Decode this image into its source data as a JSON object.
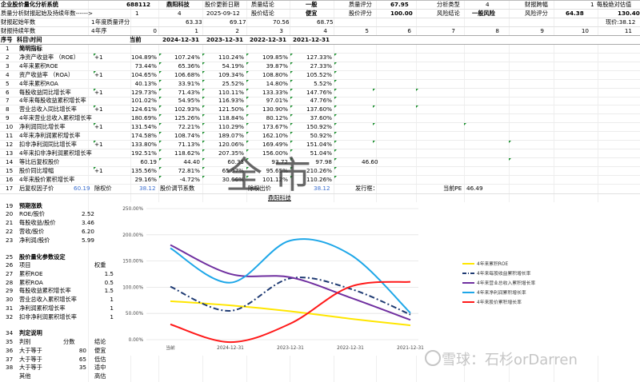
{
  "top": {
    "row1": {
      "c1": "企业股价量化分析系统",
      "c2": "688112",
      "c3": "鼎阳科技",
      "c4": "股价更新日期",
      "c5": "质量结论",
      "c6": "一般",
      "c7": "质量评分",
      "c8": "67.95",
      "c9": "分析类型",
      "c10": "4",
      "c11": "财报跨幅",
      "c12": "1",
      "c13": "每股绝对估值"
    },
    "row2": {
      "c1": "质量分析财报起始及持续年数------>",
      "c2": "1",
      "c3": "4",
      "c4": "2025-09-12",
      "c5": "股价结论",
      "c6": "便宜",
      "c7": "股价评分",
      "c8": "100.00",
      "c9": "风险结论",
      "c10": "一般风险",
      "c11": "风险评分",
      "c12": "64.38",
      "c13": "130.40"
    },
    "row3": {
      "c1": "财报起始年数",
      "c2": "1",
      "c3": "年度质量评分",
      "c4": "63.33",
      "c5": "69.17",
      "c6": "70.56",
      "c7": "68.75",
      "c8": "现价:38.12"
    },
    "row4": {
      "c1": "财报持续年数",
      "c2": "4",
      "c3": "年序",
      "n": [
        "0",
        "1",
        "2",
        "3",
        "4",
        "5",
        "6",
        "7",
        "8",
        "9",
        "10",
        "11"
      ]
    }
  },
  "header": {
    "idx": "序号",
    "item": "科目\\时间",
    "cols": [
      "当前",
      "2024-12-31",
      "2023-12-31",
      "2022-12-31",
      "2021-12-31"
    ]
  },
  "table": [
    {
      "n": "1",
      "name": "简明指标",
      "b": true,
      "flag": "",
      "v": []
    },
    {
      "n": "2",
      "name": "净资产收益率 （ROE）",
      "flag": "+1",
      "v": [
        "104.89%",
        "107.24%",
        "110.24%",
        "109.85%",
        "127.33%"
      ]
    },
    {
      "n": "3",
      "name": "4年来累积ROE",
      "flag": "",
      "v": [
        "73.44%",
        "65.36%",
        "54.19%",
        "39.87%",
        "27.33%"
      ]
    },
    {
      "n": "4",
      "name": "资产收益率 （ROA）",
      "flag": "+1",
      "v": [
        "104.65%",
        "106.68%",
        "109.34%",
        "108.80%",
        "105.52%"
      ]
    },
    {
      "n": "5",
      "name": "4年来累积ROA",
      "flag": "",
      "v": [
        "40.13%",
        "33.91%",
        "25.52%",
        "14.80%",
        "5.52%"
      ]
    },
    {
      "n": "6",
      "name": "每股收益同比增长率",
      "flag": "+1",
      "v": [
        "129.73%",
        "71.43%",
        "110.11%",
        "133.33%",
        "147.76%"
      ]
    },
    {
      "n": "7",
      "name": "4年来每股收益累积增长率",
      "flag": "",
      "v": [
        "101.02%",
        "54.95%",
        "116.93%",
        "97.01%",
        "47.76%"
      ]
    },
    {
      "n": "8",
      "name": "营业总收入同比增长率",
      "flag": "+1",
      "v": [
        "124.61%",
        "102.93%",
        "121.50%",
        "130.90%",
        "137.60%"
      ]
    },
    {
      "n": "9",
      "name": "4年来营业总收入累积增长率",
      "flag": "",
      "v": [
        "180.69%",
        "125.26%",
        "118.84%",
        "80.12%",
        "37.60%"
      ]
    },
    {
      "n": "10",
      "name": "净利润同比增长率",
      "flag": "+1",
      "v": [
        "131.54%",
        "72.21%",
        "110.29%",
        "173.67%",
        "150.92%"
      ]
    },
    {
      "n": "11",
      "name": "4年来净利润累积增长率",
      "flag": "",
      "v": [
        "174.58%",
        "108.74%",
        "189.07%",
        "162.10%",
        "50.92%"
      ]
    },
    {
      "n": "12",
      "name": "扣非净利润同比增长率",
      "flag": "+1",
      "v": [
        "133.80%",
        "71.13%",
        "120.06%",
        "169.49%",
        "151.04%"
      ]
    },
    {
      "n": "13",
      "name": "4年来扣非净利润累积增长率",
      "flag": "",
      "v": [
        "192.51%",
        "118.62%",
        "207.35%",
        "156.00%",
        "51.04%"
      ]
    },
    {
      "n": "14",
      "name": "等比后复权股价",
      "flag": "",
      "v": [
        "60.19",
        "44.40",
        "60.33",
        "93.72",
        "97.98"
      ],
      "extra": "46.60"
    },
    {
      "n": "15",
      "name": "股价同比增幅",
      "flag": "+1",
      "v": [
        "135.56%",
        "72.81%",
        "65.07%",
        "95.65%",
        "210.26%"
      ]
    },
    {
      "n": "16",
      "name": "4年来股价累积增长率",
      "flag": "",
      "v": [
        "29.16%",
        "-4.72%",
        "30.66%",
        "101.12%",
        "110.26%"
      ]
    }
  ],
  "row17": {
    "n": "17",
    "a": "后复权因子价",
    "b": "60.19",
    "c": "除权价",
    "d": "38.12",
    "e": "股价调节系数",
    "f": "除权出价",
    "g": "38.12",
    "h": "发行框：",
    "i": "当前PE",
    "j": "46.49"
  },
  "company_tag": "鼎阳科技",
  "forecast": {
    "title_n": "19",
    "title": "预期涨跌",
    "rows": [
      {
        "n": "20",
        "name": "ROE/股价",
        "v": "2.52"
      },
      {
        "n": "21",
        "name": "每股收益/股价",
        "v": "3.46"
      },
      {
        "n": "22",
        "name": "营收/股价",
        "v": "6.20"
      },
      {
        "n": "23",
        "name": "净利润/股价",
        "v": "5.99"
      }
    ]
  },
  "params": {
    "title_n": "25",
    "title": "股价量化参数设定",
    "head_n": "26",
    "head_a": "项目",
    "head_b": "权重",
    "rows": [
      {
        "n": "27",
        "name": "累积ROE",
        "v": "1.5"
      },
      {
        "n": "28",
        "name": "累积ROA",
        "v": "0.5"
      },
      {
        "n": "29",
        "name": "每股收益累积增长率",
        "v": "1.5"
      },
      {
        "n": "30",
        "name": "营业总收入累积增长率",
        "v": "1"
      },
      {
        "n": "31",
        "name": "净利润累积增长率",
        "v": "1"
      },
      {
        "n": "32",
        "name": "扣非净利润累积增长率",
        "v": "1"
      }
    ]
  },
  "judge": {
    "title_n": "34",
    "title": "判定说明",
    "head_n": "35",
    "head_a": "判别",
    "head_b": "分数",
    "head_c": "结论",
    "rows": [
      {
        "n": "36",
        "a": "大于等于",
        "b": "80",
        "c": "便宜"
      },
      {
        "n": "37",
        "a": "大于等于",
        "b": "65",
        "c": "低估"
      },
      {
        "n": "38",
        "a": "大于等于",
        "b": "35",
        "c": "适中"
      },
      {
        "n": "",
        "a": "其他",
        "b": "",
        "c": "高估"
      }
    ]
  },
  "watermark": {
    "big": "全 市",
    "small": "雪球：石杉orDarren"
  },
  "chart_data": {
    "type": "line",
    "categories": [
      "当前",
      "2024-12-31",
      "2023-12-31",
      "2022-12-31",
      "2021-12-31"
    ],
    "ylim": [
      0,
      250
    ],
    "yticks": [
      "0.00%",
      "50.00%",
      "100.00%",
      "150.00%",
      "200.00%",
      "250.00%"
    ],
    "series": [
      {
        "name": "4年来累积ROE",
        "color": "#ffe600",
        "values": [
          73.44,
          65.36,
          54.19,
          39.87,
          27.33
        ]
      },
      {
        "name": "4年来每股收益累积增长率",
        "color": "#1f3b73",
        "dash": true,
        "values": [
          101.02,
          54.95,
          116.93,
          97.01,
          47.76
        ]
      },
      {
        "name": "4年来营业总收入累积增长率",
        "color": "#7030a0",
        "values": [
          180.69,
          125.26,
          118.84,
          80.12,
          37.6
        ]
      },
      {
        "name": "4年来净利润累积增长率",
        "color": "#1ea7e8",
        "values": [
          174.58,
          108.74,
          189.07,
          162.1,
          50.92
        ]
      },
      {
        "name": "4年来股价累积增长率",
        "color": "#ff1a1a",
        "values": [
          29.16,
          -4.72,
          30.66,
          101.12,
          110.26
        ]
      }
    ]
  }
}
